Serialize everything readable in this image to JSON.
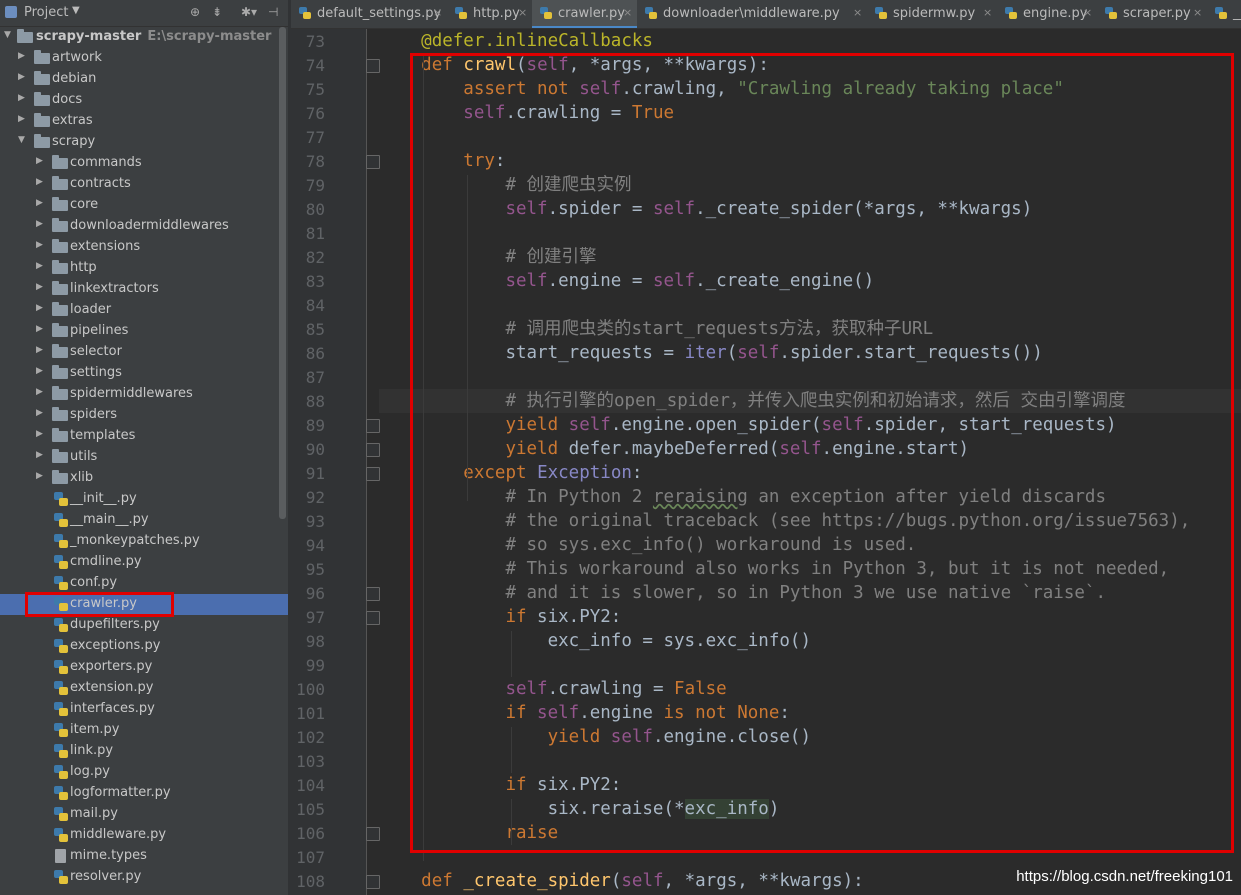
{
  "project_panel": {
    "title": "Project",
    "root": {
      "name": "scrapy-master",
      "path": "E:\\scrapy-master"
    },
    "items": [
      {
        "label": "artwork",
        "type": "folder",
        "depth": 1,
        "expanded": false
      },
      {
        "label": "debian",
        "type": "folder",
        "depth": 1,
        "expanded": false
      },
      {
        "label": "docs",
        "type": "folder",
        "depth": 1,
        "expanded": false
      },
      {
        "label": "extras",
        "type": "folder",
        "depth": 1,
        "expanded": false
      },
      {
        "label": "scrapy",
        "type": "folder",
        "depth": 1,
        "expanded": true
      },
      {
        "label": "commands",
        "type": "folder",
        "depth": 2,
        "expanded": false
      },
      {
        "label": "contracts",
        "type": "folder",
        "depth": 2,
        "expanded": false
      },
      {
        "label": "core",
        "type": "folder",
        "depth": 2,
        "expanded": false
      },
      {
        "label": "downloadermiddlewares",
        "type": "folder",
        "depth": 2,
        "expanded": false
      },
      {
        "label": "extensions",
        "type": "folder",
        "depth": 2,
        "expanded": false
      },
      {
        "label": "http",
        "type": "folder",
        "depth": 2,
        "expanded": false
      },
      {
        "label": "linkextractors",
        "type": "folder",
        "depth": 2,
        "expanded": false
      },
      {
        "label": "loader",
        "type": "folder",
        "depth": 2,
        "expanded": false
      },
      {
        "label": "pipelines",
        "type": "folder",
        "depth": 2,
        "expanded": false
      },
      {
        "label": "selector",
        "type": "folder",
        "depth": 2,
        "expanded": false
      },
      {
        "label": "settings",
        "type": "folder",
        "depth": 2,
        "expanded": false
      },
      {
        "label": "spidermiddlewares",
        "type": "folder",
        "depth": 2,
        "expanded": false
      },
      {
        "label": "spiders",
        "type": "folder",
        "depth": 2,
        "expanded": false
      },
      {
        "label": "templates",
        "type": "folder",
        "depth": 2,
        "expanded": false
      },
      {
        "label": "utils",
        "type": "folder",
        "depth": 2,
        "expanded": false
      },
      {
        "label": "xlib",
        "type": "folder",
        "depth": 2,
        "expanded": false
      },
      {
        "label": "__init__.py",
        "type": "py",
        "depth": 2
      },
      {
        "label": "__main__.py",
        "type": "py",
        "depth": 2
      },
      {
        "label": "_monkeypatches.py",
        "type": "py",
        "depth": 2
      },
      {
        "label": "cmdline.py",
        "type": "py",
        "depth": 2
      },
      {
        "label": "conf.py",
        "type": "py",
        "depth": 2
      },
      {
        "label": "crawler.py",
        "type": "py",
        "depth": 2,
        "selected": true
      },
      {
        "label": "dupefilters.py",
        "type": "py",
        "depth": 2
      },
      {
        "label": "exceptions.py",
        "type": "py",
        "depth": 2
      },
      {
        "label": "exporters.py",
        "type": "py",
        "depth": 2
      },
      {
        "label": "extension.py",
        "type": "py",
        "depth": 2
      },
      {
        "label": "interfaces.py",
        "type": "py",
        "depth": 2
      },
      {
        "label": "item.py",
        "type": "py",
        "depth": 2
      },
      {
        "label": "link.py",
        "type": "py",
        "depth": 2
      },
      {
        "label": "log.py",
        "type": "py",
        "depth": 2
      },
      {
        "label": "logformatter.py",
        "type": "py",
        "depth": 2
      },
      {
        "label": "mail.py",
        "type": "py",
        "depth": 2
      },
      {
        "label": "middleware.py",
        "type": "py",
        "depth": 2
      },
      {
        "label": "mime.types",
        "type": "txt",
        "depth": 2
      },
      {
        "label": "resolver.py",
        "type": "py",
        "depth": 2
      }
    ]
  },
  "tabs": [
    {
      "label": "default_settings.py",
      "active": false
    },
    {
      "label": "http.py",
      "active": false
    },
    {
      "label": "crawler.py",
      "active": true
    },
    {
      "label": "downloader\\middleware.py",
      "active": false
    },
    {
      "label": "spidermw.py",
      "active": false
    },
    {
      "label": "engine.py",
      "active": false
    },
    {
      "label": "scraper.py",
      "active": false
    },
    {
      "label": "__i",
      "active": false
    }
  ],
  "editor": {
    "first_line": 73,
    "lines": [
      [
        [
          "    ",
          "tx"
        ],
        [
          "@defer.inlineCallbacks",
          "dc"
        ]
      ],
      [
        [
          "    ",
          "tx"
        ],
        [
          "def ",
          "kw"
        ],
        [
          "crawl",
          "fn"
        ],
        [
          "(",
          "tx"
        ],
        [
          "self",
          "sf"
        ],
        [
          ", *args, **kwargs):",
          "tx"
        ]
      ],
      [
        [
          "        ",
          "tx"
        ],
        [
          "assert not ",
          "kw"
        ],
        [
          "self",
          "sf"
        ],
        [
          ".crawling, ",
          "tx"
        ],
        [
          "\"Crawling already taking place\"",
          "st"
        ]
      ],
      [
        [
          "        ",
          "tx"
        ],
        [
          "self",
          "sf"
        ],
        [
          ".crawling = ",
          "tx"
        ],
        [
          "True",
          "kw"
        ]
      ],
      [],
      [
        [
          "        ",
          "tx"
        ],
        [
          "try",
          "kw"
        ],
        [
          ":",
          "tx"
        ]
      ],
      [
        [
          "            ",
          "tx"
        ],
        [
          "# 创建爬虫实例",
          "cm"
        ]
      ],
      [
        [
          "            ",
          "tx"
        ],
        [
          "self",
          "sf"
        ],
        [
          ".spider = ",
          "tx"
        ],
        [
          "self",
          "sf"
        ],
        [
          "._create_spider(*args, **kwargs)",
          "tx"
        ]
      ],
      [],
      [
        [
          "            ",
          "tx"
        ],
        [
          "# 创建引擎",
          "cm"
        ]
      ],
      [
        [
          "            ",
          "tx"
        ],
        [
          "self",
          "sf"
        ],
        [
          ".engine = ",
          "tx"
        ],
        [
          "self",
          "sf"
        ],
        [
          "._create_engine()",
          "tx"
        ]
      ],
      [],
      [
        [
          "            ",
          "tx"
        ],
        [
          "# 调用爬虫类的start_requests方法，获取种子URL",
          "cm"
        ]
      ],
      [
        [
          "            ",
          "tx"
        ],
        [
          "start_requests = ",
          "tx"
        ],
        [
          "iter",
          "bi"
        ],
        [
          "(",
          "tx"
        ],
        [
          "self",
          "sf"
        ],
        [
          ".spider.start_requests())",
          "tx"
        ]
      ],
      [],
      [
        [
          "            ",
          "tx"
        ],
        [
          "# 执行引擎的open_spider，并传入爬虫实例和初始请求，然后 交由引擎调度",
          "cm"
        ]
      ],
      [
        [
          "            ",
          "tx"
        ],
        [
          "yield ",
          "kw"
        ],
        [
          "self",
          "sf"
        ],
        [
          ".engine.open_spider(",
          "tx"
        ],
        [
          "self",
          "sf"
        ],
        [
          ".spider, start_requests)",
          "tx"
        ]
      ],
      [
        [
          "            ",
          "tx"
        ],
        [
          "yield ",
          "kw"
        ],
        [
          "defer.maybeDeferred(",
          "tx"
        ],
        [
          "self",
          "sf"
        ],
        [
          ".engine.start)",
          "tx"
        ]
      ],
      [
        [
          "        ",
          "tx"
        ],
        [
          "except ",
          "kw"
        ],
        [
          "Exception",
          "bi"
        ],
        [
          ":",
          "tx"
        ]
      ],
      [
        [
          "            ",
          "tx"
        ],
        [
          "# In Python 2 ",
          "cm"
        ],
        [
          "reraising",
          "cm ul"
        ],
        [
          " an exception after yield discards",
          "cm"
        ]
      ],
      [
        [
          "            ",
          "tx"
        ],
        [
          "# the original traceback (see https://bugs.python.org/issue7563),",
          "cm"
        ]
      ],
      [
        [
          "            ",
          "tx"
        ],
        [
          "# so sys.exc_info() workaround is used.",
          "cm"
        ]
      ],
      [
        [
          "            ",
          "tx"
        ],
        [
          "# This workaround also works in Python 3, but it is not needed,",
          "cm"
        ]
      ],
      [
        [
          "            ",
          "tx"
        ],
        [
          "# and it is slower, so in Python 3 we use native `raise`.",
          "cm"
        ]
      ],
      [
        [
          "            ",
          "tx"
        ],
        [
          "if ",
          "kw"
        ],
        [
          "six.PY2:",
          "tx"
        ]
      ],
      [
        [
          "                ",
          "tx"
        ],
        [
          "exc_info = sys.exc_info()",
          "tx"
        ]
      ],
      [],
      [
        [
          "            ",
          "tx"
        ],
        [
          "self",
          "sf"
        ],
        [
          ".crawling = ",
          "tx"
        ],
        [
          "False",
          "kw"
        ]
      ],
      [
        [
          "            ",
          "tx"
        ],
        [
          "if ",
          "kw"
        ],
        [
          "self",
          "sf"
        ],
        [
          ".engine ",
          "tx"
        ],
        [
          "is not None",
          "kw"
        ],
        [
          ":",
          "tx"
        ]
      ],
      [
        [
          "                ",
          "tx"
        ],
        [
          "yield ",
          "kw"
        ],
        [
          "self",
          "sf"
        ],
        [
          ".engine.close()",
          "tx"
        ]
      ],
      [],
      [
        [
          "            ",
          "tx"
        ],
        [
          "if ",
          "kw"
        ],
        [
          "six.PY2:",
          "tx"
        ]
      ],
      [
        [
          "                ",
          "tx"
        ],
        [
          "six.reraise(*",
          "tx"
        ],
        [
          "exc_info",
          "tx hv"
        ],
        [
          ")",
          "tx"
        ]
      ],
      [
        [
          "            ",
          "tx"
        ],
        [
          "raise",
          "kw"
        ]
      ],
      [],
      [
        [
          "    ",
          "tx"
        ],
        [
          "def ",
          "kw"
        ],
        [
          "_create_spider",
          "fn"
        ],
        [
          "(",
          "tx"
        ],
        [
          "self",
          "sf"
        ],
        [
          ", *args, **kwargs):",
          "tx"
        ]
      ]
    ]
  },
  "watermark": "https://blog.csdn.net/freeking101",
  "colors": {
    "selection": "#4b6eaf",
    "annotation_box": "#e00000",
    "active_tab_underline": "#4a88c7"
  }
}
